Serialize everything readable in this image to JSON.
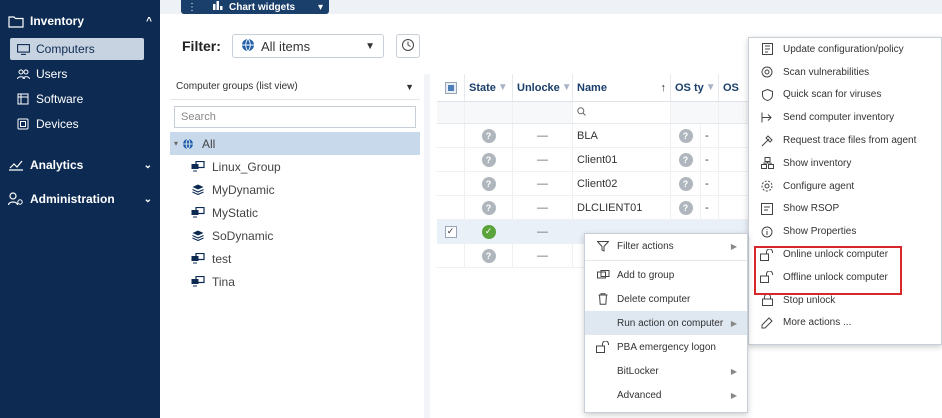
{
  "sidebar": {
    "inventory_label": "Inventory",
    "items": [
      {
        "label": "Computers",
        "icon": "monitor-icon"
      },
      {
        "label": "Users",
        "icon": "users-icon"
      },
      {
        "label": "Software",
        "icon": "software-icon"
      },
      {
        "label": "Devices",
        "icon": "devices-icon"
      }
    ],
    "analytics_label": "Analytics",
    "administration_label": "Administration"
  },
  "topbar": {
    "chart_widgets_label": "Chart widgets"
  },
  "filter": {
    "label": "Filter:",
    "selected": "All items"
  },
  "groups": {
    "header": "Computer groups (list view)",
    "search_placeholder": "Search",
    "tree": [
      {
        "label": "All",
        "icon": "globe-icon"
      },
      {
        "label": "Linux_Group",
        "icon": "computer-group-icon"
      },
      {
        "label": "MyDynamic",
        "icon": "dynamic-group-icon"
      },
      {
        "label": "MyStatic",
        "icon": "computer-group-icon"
      },
      {
        "label": "SoDynamic",
        "icon": "dynamic-group-icon"
      },
      {
        "label": "test",
        "icon": "computer-group-icon"
      },
      {
        "label": "Tina",
        "icon": "computer-group-icon"
      }
    ]
  },
  "grid": {
    "columns": {
      "state": "State",
      "unlocked": "Unlocke",
      "name": "Name",
      "os_type": "OS ty",
      "os": "OS"
    },
    "rows": [
      {
        "name": "BLA",
        "os": "-",
        "unlocked": "—"
      },
      {
        "name": "Client01",
        "os": "-",
        "unlocked": "—"
      },
      {
        "name": "Client02",
        "os": "-",
        "unlocked": "—"
      },
      {
        "name": "DLCLIENT01",
        "os": "-",
        "unlocked": "—"
      },
      {
        "name": "",
        "os": "",
        "unlocked": "—"
      },
      {
        "name": "",
        "os": "",
        "unlocked": "—"
      }
    ]
  },
  "context_menu": {
    "filter_actions": "Filter actions",
    "add_to_group": "Add to group",
    "delete_computer": "Delete computer",
    "run_action": "Run action on computer",
    "pba_logon": "PBA emergency logon",
    "bitlocker": "BitLocker",
    "advanced": "Advanced"
  },
  "submenu": {
    "items": [
      "Update configuration/policy",
      "Scan vulnerabilities",
      "Quick scan for viruses",
      "Send computer inventory",
      "Request trace files from agent",
      "Show inventory",
      "Configure agent",
      "Show RSOP",
      "Show Properties",
      "Online unlock computer",
      "Offline unlock computer",
      "Stop unlock",
      "More actions ..."
    ]
  },
  "colors": {
    "sidebar_bg": "#0d2b52",
    "highlight_border": "#d8262b",
    "ok_green": "#5ba33b"
  }
}
